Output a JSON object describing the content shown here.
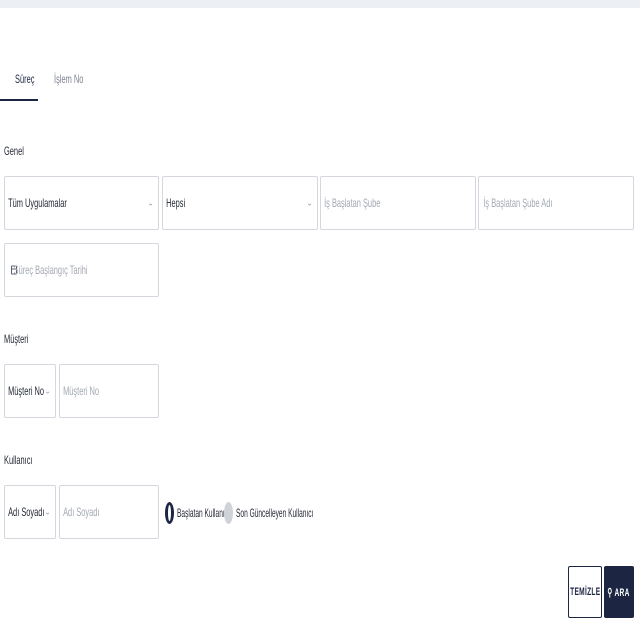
{
  "tabs": [
    {
      "label": "Süreç",
      "active": true
    },
    {
      "label": "İşlem No",
      "active": false
    }
  ],
  "sections": {
    "general": "Genel",
    "customer": "Müşteri",
    "user": "Kullanıcı"
  },
  "general": {
    "app_select": "Tüm Uygulamalar",
    "status_select": "Hepsi",
    "branch_placeholder": "İş Başlatan Şube",
    "branch_name_placeholder": "İş Başlatan Şube Adı",
    "date_placeholder": "Süreç Başlangıç Tarihi"
  },
  "customer": {
    "type_select": "Müşteri No",
    "value_placeholder": "Müşteri No"
  },
  "user": {
    "type_select": "Adı Soyadı",
    "value_placeholder": "Adı Soyadı",
    "radio_options": [
      {
        "label": "Başlatan Kullanıcı",
        "selected": true
      },
      {
        "label": "Son Güncelleyen Kullanıcı",
        "selected": false
      }
    ]
  },
  "actions": {
    "clear_label": "TEMİZLE",
    "search_label": "ARA"
  },
  "colors": {
    "primary": "#1c2542",
    "border": "#d4d7dd",
    "topbar": "#eceff3"
  },
  "icons": {
    "select_chevron": "chevron-down-icon",
    "date": "calendar-icon",
    "search": "search-icon"
  }
}
